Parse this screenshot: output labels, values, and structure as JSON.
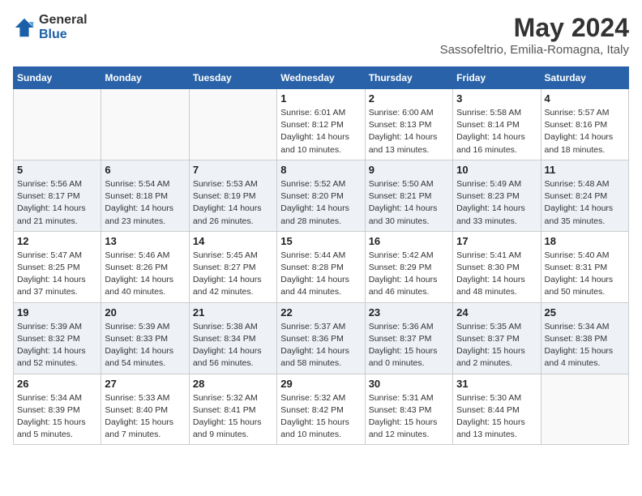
{
  "header": {
    "logo_general": "General",
    "logo_blue": "Blue",
    "month": "May 2024",
    "location": "Sassofeltrio, Emilia-Romagna, Italy"
  },
  "days_of_week": [
    "Sunday",
    "Monday",
    "Tuesday",
    "Wednesday",
    "Thursday",
    "Friday",
    "Saturday"
  ],
  "weeks": [
    [
      {
        "day": "",
        "info": ""
      },
      {
        "day": "",
        "info": ""
      },
      {
        "day": "",
        "info": ""
      },
      {
        "day": "1",
        "info": "Sunrise: 6:01 AM\nSunset: 8:12 PM\nDaylight: 14 hours\nand 10 minutes."
      },
      {
        "day": "2",
        "info": "Sunrise: 6:00 AM\nSunset: 8:13 PM\nDaylight: 14 hours\nand 13 minutes."
      },
      {
        "day": "3",
        "info": "Sunrise: 5:58 AM\nSunset: 8:14 PM\nDaylight: 14 hours\nand 16 minutes."
      },
      {
        "day": "4",
        "info": "Sunrise: 5:57 AM\nSunset: 8:16 PM\nDaylight: 14 hours\nand 18 minutes."
      }
    ],
    [
      {
        "day": "5",
        "info": "Sunrise: 5:56 AM\nSunset: 8:17 PM\nDaylight: 14 hours\nand 21 minutes."
      },
      {
        "day": "6",
        "info": "Sunrise: 5:54 AM\nSunset: 8:18 PM\nDaylight: 14 hours\nand 23 minutes."
      },
      {
        "day": "7",
        "info": "Sunrise: 5:53 AM\nSunset: 8:19 PM\nDaylight: 14 hours\nand 26 minutes."
      },
      {
        "day": "8",
        "info": "Sunrise: 5:52 AM\nSunset: 8:20 PM\nDaylight: 14 hours\nand 28 minutes."
      },
      {
        "day": "9",
        "info": "Sunrise: 5:50 AM\nSunset: 8:21 PM\nDaylight: 14 hours\nand 30 minutes."
      },
      {
        "day": "10",
        "info": "Sunrise: 5:49 AM\nSunset: 8:23 PM\nDaylight: 14 hours\nand 33 minutes."
      },
      {
        "day": "11",
        "info": "Sunrise: 5:48 AM\nSunset: 8:24 PM\nDaylight: 14 hours\nand 35 minutes."
      }
    ],
    [
      {
        "day": "12",
        "info": "Sunrise: 5:47 AM\nSunset: 8:25 PM\nDaylight: 14 hours\nand 37 minutes."
      },
      {
        "day": "13",
        "info": "Sunrise: 5:46 AM\nSunset: 8:26 PM\nDaylight: 14 hours\nand 40 minutes."
      },
      {
        "day": "14",
        "info": "Sunrise: 5:45 AM\nSunset: 8:27 PM\nDaylight: 14 hours\nand 42 minutes."
      },
      {
        "day": "15",
        "info": "Sunrise: 5:44 AM\nSunset: 8:28 PM\nDaylight: 14 hours\nand 44 minutes."
      },
      {
        "day": "16",
        "info": "Sunrise: 5:42 AM\nSunset: 8:29 PM\nDaylight: 14 hours\nand 46 minutes."
      },
      {
        "day": "17",
        "info": "Sunrise: 5:41 AM\nSunset: 8:30 PM\nDaylight: 14 hours\nand 48 minutes."
      },
      {
        "day": "18",
        "info": "Sunrise: 5:40 AM\nSunset: 8:31 PM\nDaylight: 14 hours\nand 50 minutes."
      }
    ],
    [
      {
        "day": "19",
        "info": "Sunrise: 5:39 AM\nSunset: 8:32 PM\nDaylight: 14 hours\nand 52 minutes."
      },
      {
        "day": "20",
        "info": "Sunrise: 5:39 AM\nSunset: 8:33 PM\nDaylight: 14 hours\nand 54 minutes."
      },
      {
        "day": "21",
        "info": "Sunrise: 5:38 AM\nSunset: 8:34 PM\nDaylight: 14 hours\nand 56 minutes."
      },
      {
        "day": "22",
        "info": "Sunrise: 5:37 AM\nSunset: 8:36 PM\nDaylight: 14 hours\nand 58 minutes."
      },
      {
        "day": "23",
        "info": "Sunrise: 5:36 AM\nSunset: 8:37 PM\nDaylight: 15 hours\nand 0 minutes."
      },
      {
        "day": "24",
        "info": "Sunrise: 5:35 AM\nSunset: 8:37 PM\nDaylight: 15 hours\nand 2 minutes."
      },
      {
        "day": "25",
        "info": "Sunrise: 5:34 AM\nSunset: 8:38 PM\nDaylight: 15 hours\nand 4 minutes."
      }
    ],
    [
      {
        "day": "26",
        "info": "Sunrise: 5:34 AM\nSunset: 8:39 PM\nDaylight: 15 hours\nand 5 minutes."
      },
      {
        "day": "27",
        "info": "Sunrise: 5:33 AM\nSunset: 8:40 PM\nDaylight: 15 hours\nand 7 minutes."
      },
      {
        "day": "28",
        "info": "Sunrise: 5:32 AM\nSunset: 8:41 PM\nDaylight: 15 hours\nand 9 minutes."
      },
      {
        "day": "29",
        "info": "Sunrise: 5:32 AM\nSunset: 8:42 PM\nDaylight: 15 hours\nand 10 minutes."
      },
      {
        "day": "30",
        "info": "Sunrise: 5:31 AM\nSunset: 8:43 PM\nDaylight: 15 hours\nand 12 minutes."
      },
      {
        "day": "31",
        "info": "Sunrise: 5:30 AM\nSunset: 8:44 PM\nDaylight: 15 hours\nand 13 minutes."
      },
      {
        "day": "",
        "info": ""
      }
    ]
  ]
}
